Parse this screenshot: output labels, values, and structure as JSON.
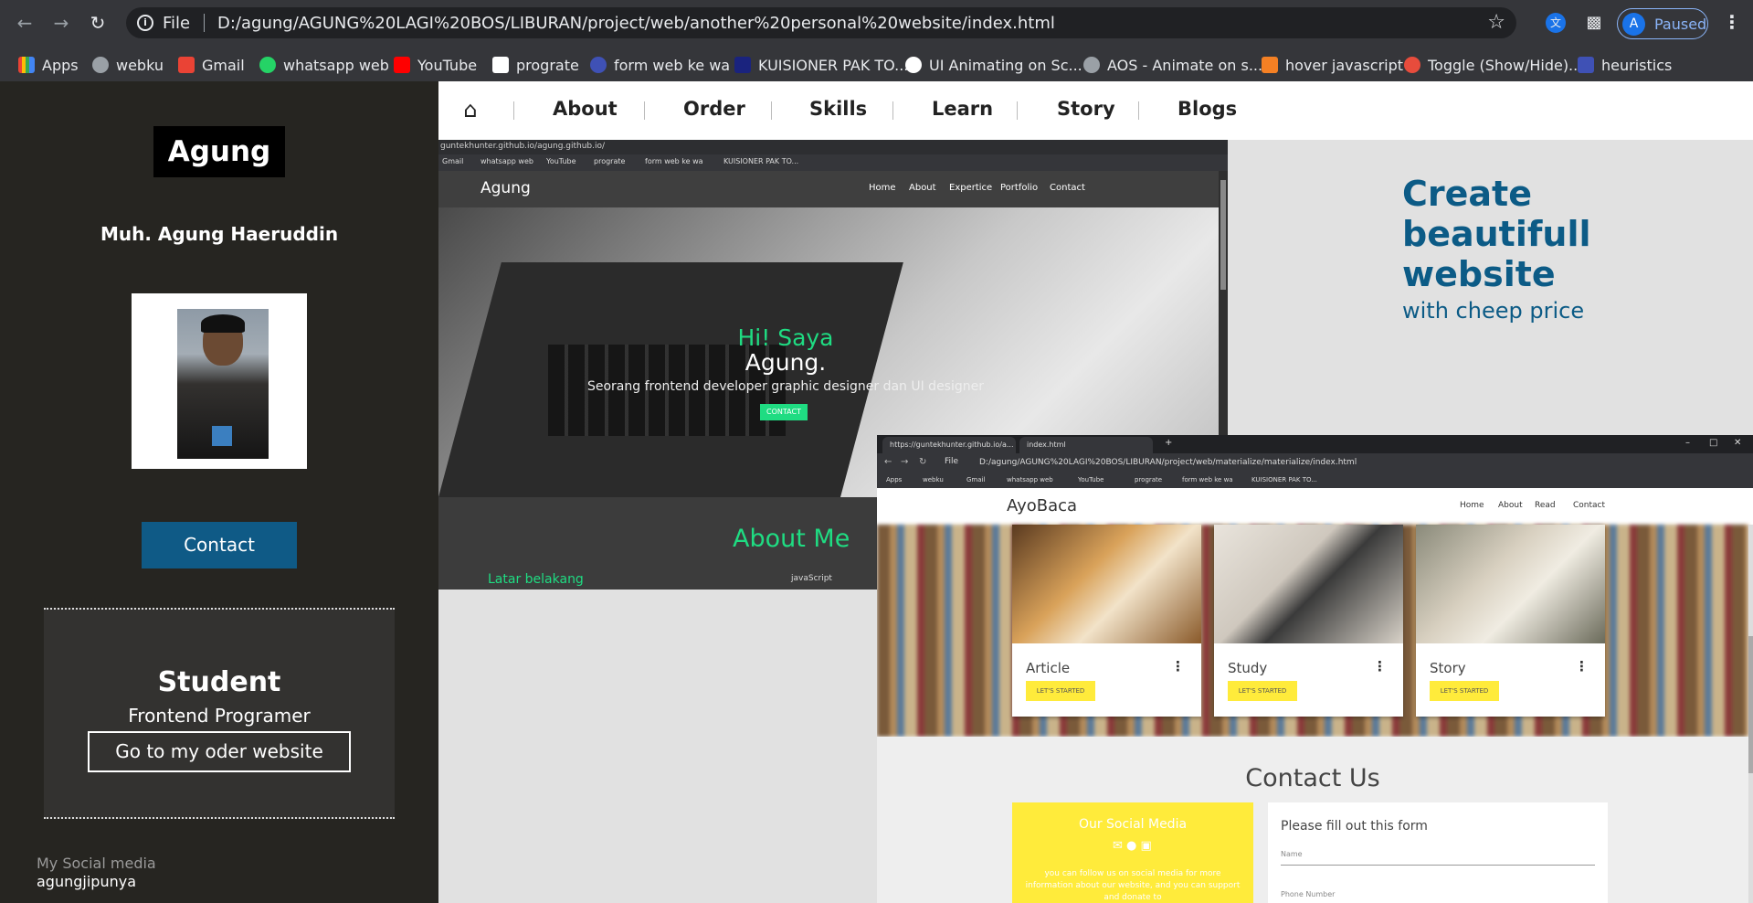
{
  "browser": {
    "file_label": "File",
    "url": "D:/agung/AGUNG%20LAGI%20BOS/LIBURAN/project/web/another%20personal%20website/index.html",
    "profile_initial": "A",
    "profile_status": "Paused"
  },
  "bookmarks": [
    {
      "label": "Apps",
      "color": "#ea4335"
    },
    {
      "label": "webku",
      "color": "#9aa0a6"
    },
    {
      "label": "Gmail",
      "color": "#ea4335"
    },
    {
      "label": "whatsapp web",
      "color": "#25d366"
    },
    {
      "label": "YouTube",
      "color": "#ff0000"
    },
    {
      "label": "prograte",
      "color": "#ffffff"
    },
    {
      "label": "form web ke wa",
      "color": "#3f51b5"
    },
    {
      "label": "KUISIONER PAK TO...",
      "color": "#1a237e"
    },
    {
      "label": "UI Animating on Sc...",
      "color": "#ffffff"
    },
    {
      "label": "AOS - Animate on s...",
      "color": "#9aa0a6"
    },
    {
      "label": "hover javascript",
      "color": "#f48024"
    },
    {
      "label": "Toggle (Show/Hide)...",
      "color": "#e74c3c"
    },
    {
      "label": "heuristics",
      "color": "#3f51b5"
    }
  ],
  "sidebar": {
    "logo": "Agung",
    "full_name": "Muh. Agung Haeruddin",
    "contact_button": "Contact",
    "student_title": "Student",
    "student_subtitle": "Frontend Programer",
    "order_button": "Go to my oder website",
    "social_label": "My Social media",
    "social_handle": "agungjipunya"
  },
  "main_nav": {
    "items": [
      "About",
      "Order",
      "Skills",
      "Learn",
      "Story",
      "Blogs"
    ]
  },
  "hero": {
    "title": "Create beautifull website",
    "subtitle": "with cheep price"
  },
  "shot1": {
    "url": "guntekhunter.github.io/agung.github.io/",
    "bookmarks": [
      "Gmail",
      "whatsapp web",
      "YouTube",
      "prograte",
      "form web ke wa",
      "KUISIONER PAK TO..."
    ],
    "brand": "Agung",
    "links": [
      "Home",
      "About",
      "Expertice",
      "Portfolio",
      "Contact"
    ],
    "greeting": "Hi! Saya",
    "name": "Agung.",
    "description": "Seorang frontend developer graphic designer dan UI designer",
    "button": "CONTACT",
    "about_title": "About Me",
    "about_left": "Latar belakang",
    "about_right": "javaScript"
  },
  "shot2": {
    "tab1": "https://guntekhunter.github.io/a...",
    "tab2": "index.html",
    "file_label": "File",
    "url": "D:/agung/AGUNG%20LAGI%20BOS/LIBURAN/project/web/materialize/materialize/index.html",
    "bookmarks": [
      "Apps",
      "webku",
      "Gmail",
      "whatsapp web",
      "YouTube",
      "prograte",
      "form web ke wa",
      "KUISIONER PAK TO..."
    ],
    "brand": "AyoBaca",
    "links": [
      "Home",
      "About",
      "Read",
      "Contact"
    ],
    "cards": [
      {
        "title": "Article",
        "button": "LET'S STARTED"
      },
      {
        "title": "Study",
        "button": "LET'S STARTED"
      },
      {
        "title": "Story",
        "button": "LET'S STARTED"
      }
    ],
    "contact_title": "Contact Us",
    "social_title": "Our Social Media",
    "social_text": "you can follow us on social media for more information about our website, and you can support and donate to",
    "form_title": "Please fill out this form",
    "field_name": "Name",
    "field_phone": "Phone Number"
  }
}
